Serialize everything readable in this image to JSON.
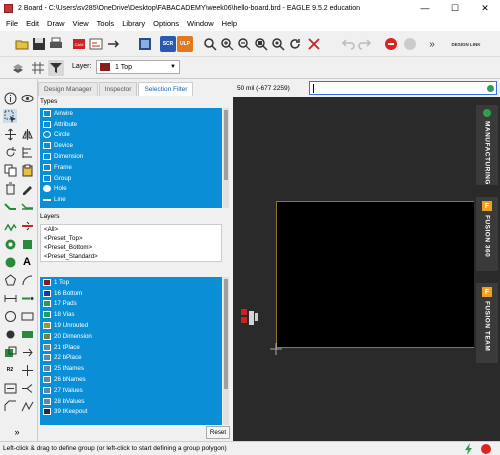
{
  "window": {
    "title": "2 Board - C:\\Users\\sv285\\OneDrive\\Desktop\\FABACADEMY\\week06\\hello-board.brd - EAGLE 9.5.2 education",
    "minimize": "—",
    "maximize": "☐",
    "close": "✕"
  },
  "menu": [
    "File",
    "Edit",
    "Draw",
    "View",
    "Tools",
    "Library",
    "Options",
    "Window",
    "Help"
  ],
  "toolbar": {
    "scr_label": "SCR",
    "ulp_label": "ULP",
    "more": "»",
    "design_link": "DESIGN LINK"
  },
  "layer_toolbar": {
    "label": "Layer:",
    "selected": "1 Top",
    "selected_color": "#8b1a1a"
  },
  "panel": {
    "tabs": [
      "Design Manager",
      "Inspector",
      "Selection Filter"
    ],
    "active_tab": "Selection Filter",
    "types_label": "Types",
    "types": [
      "Airwire",
      "Attribute",
      "Circle",
      "Device",
      "Dimension",
      "Frame",
      "Group",
      "Hole",
      "Line"
    ],
    "layers_label": "Layers",
    "presets": [
      "<All>",
      "<Preset_Top>",
      "<Preset_Bottom>",
      "<Preset_Standard>"
    ],
    "layers": [
      {
        "name": "1 Top",
        "color": "#8b1a1a"
      },
      {
        "name": "16 Bottom",
        "color": "#1a3aa0"
      },
      {
        "name": "17 Pads",
        "color": "#2a9a5a"
      },
      {
        "name": "18 Vias",
        "color": "#2a9a5a"
      },
      {
        "name": "19 Unrouted",
        "color": "#9a9a2a"
      },
      {
        "name": "20 Dimension",
        "color": "#6a8a3a"
      },
      {
        "name": "21 tPlace",
        "color": "#5a8ab0"
      },
      {
        "name": "22 bPlace",
        "color": "#5a8ab0"
      },
      {
        "name": "25 tNames",
        "color": "#5a8ab0"
      },
      {
        "name": "26 bNames",
        "color": "#5a8ab0"
      },
      {
        "name": "27 tValues",
        "color": "#5a8ab0"
      },
      {
        "name": "28 bValues",
        "color": "#5a8ab0"
      },
      {
        "name": "39 tKeepout",
        "color": "#1a2a5a"
      }
    ],
    "reset": "Reset"
  },
  "canvas": {
    "coordinate": "50 mil (-677 2259)",
    "command_value": ""
  },
  "dock": {
    "manufacturing": "MANUFACTURING",
    "fusion360": "FUSION 360",
    "fusion_team": "FUSION TEAM",
    "badge": "F"
  },
  "status": {
    "message": "Left-click & drag to define group (or left-click to start defining a group polygon)"
  },
  "more_tools": "»"
}
